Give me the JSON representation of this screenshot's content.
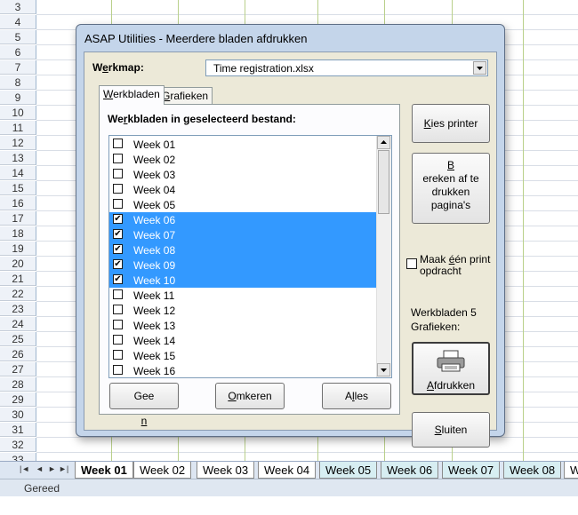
{
  "spreadsheet": {
    "rows": [
      "3",
      "4",
      "5",
      "6",
      "7",
      "8",
      "9",
      "10",
      "11",
      "12",
      "13",
      "14",
      "15",
      "16",
      "17",
      "18",
      "19",
      "20",
      "21",
      "22",
      "23",
      "24",
      "25",
      "26",
      "27",
      "28",
      "29",
      "30",
      "31",
      "32",
      "33"
    ],
    "tabs": [
      {
        "label": "Week 01",
        "active": true
      },
      {
        "label": "Week 02"
      },
      {
        "label": "Week 03"
      },
      {
        "label": "Week 04"
      },
      {
        "label": "Week 05",
        "colored": true
      },
      {
        "label": "Week 06",
        "colored": true
      },
      {
        "label": "Week 07",
        "colored": true
      },
      {
        "label": "Week 08",
        "colored": true
      },
      {
        "label": "W"
      }
    ],
    "status": "Gereed"
  },
  "dialog": {
    "title": "ASAP Utilities - Meerdere bladen afdrukken",
    "workbook_label_pre": "W",
    "workbook_label_ul": "e",
    "workbook_label_post": "rkmap:",
    "workbook_value": "Time registration.xlsx",
    "tab_sheets_pre": "",
    "tab_sheets_ul": "W",
    "tab_sheets_post": "erkbladen",
    "tab_charts_pre": "",
    "tab_charts_ul": "G",
    "tab_charts_post": "rafieken",
    "list_heading_pre": "We",
    "list_heading_ul": "r",
    "list_heading_post": "kbladen in geselecteerd bestand:",
    "sheets": [
      {
        "label": "Week 01",
        "checked": false,
        "selected": false
      },
      {
        "label": "Week 02",
        "checked": false,
        "selected": false
      },
      {
        "label": "Week 03",
        "checked": false,
        "selected": false
      },
      {
        "label": "Week 04",
        "checked": false,
        "selected": false
      },
      {
        "label": "Week 05",
        "checked": false,
        "selected": false
      },
      {
        "label": "Week 06",
        "checked": true,
        "selected": true
      },
      {
        "label": "Week 07",
        "checked": true,
        "selected": true
      },
      {
        "label": "Week 08",
        "checked": true,
        "selected": true
      },
      {
        "label": "Week 09",
        "checked": true,
        "selected": true
      },
      {
        "label": "Week 10",
        "checked": true,
        "selected": true
      },
      {
        "label": "Week 11",
        "checked": false,
        "selected": false
      },
      {
        "label": "Week 12",
        "checked": false,
        "selected": false
      },
      {
        "label": "Week 13",
        "checked": false,
        "selected": false
      },
      {
        "label": "Week 14",
        "checked": false,
        "selected": false
      },
      {
        "label": "Week 15",
        "checked": false,
        "selected": false
      },
      {
        "label": "Week 16",
        "checked": false,
        "selected": false
      }
    ],
    "btn_none_pre": "Gee",
    "btn_none_ul": "n",
    "btn_none_post": "",
    "btn_invert_pre": "",
    "btn_invert_ul": "O",
    "btn_invert_post": "mkeren",
    "btn_all_pre": "A",
    "btn_all_ul": "l",
    "btn_all_post": "les",
    "btn_choose_printer_pre": "",
    "btn_choose_printer_ul": "K",
    "btn_choose_printer_post": "ies printer",
    "btn_calc_line1_pre": "",
    "btn_calc_line1_ul": "B",
    "btn_calc_line1_post": "ereken af te",
    "btn_calc_line2": "drukken",
    "btn_calc_line3": "pagina's",
    "single_print_line1_pre": "Maak ",
    "single_print_line1_ul": "é",
    "single_print_line1_post": "én print",
    "single_print_line2": "opdracht",
    "single_print_checked": false,
    "count_sheets": "Werkbladen 5",
    "count_charts": "Grafieken:",
    "btn_print_pre": "",
    "btn_print_ul": "A",
    "btn_print_post": "fdrukken",
    "btn_close_pre": "",
    "btn_close_ul": "S",
    "btn_close_post": "luiten"
  }
}
